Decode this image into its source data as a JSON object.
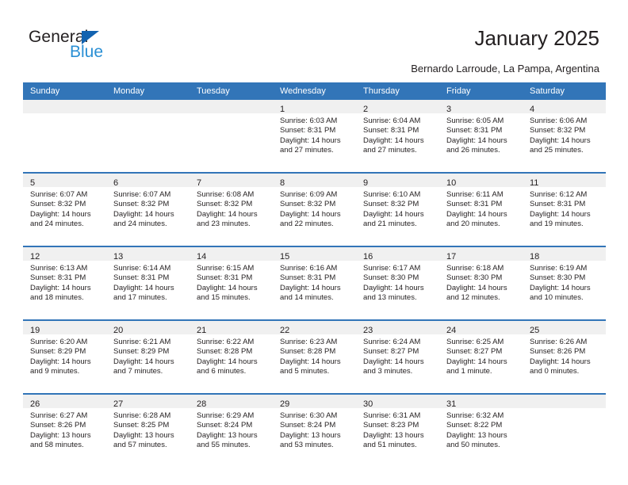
{
  "brand": {
    "name_top": "General",
    "name_bottom": "Blue",
    "accent_color": "#1263b0",
    "accent_light": "#2a8fd4"
  },
  "header": {
    "title": "January 2025",
    "subtitle": "Bernardo Larroude, La Pampa, Argentina"
  },
  "calendar": {
    "header_color": "#3275b8",
    "weekday_headers": [
      "Sunday",
      "Monday",
      "Tuesday",
      "Wednesday",
      "Thursday",
      "Friday",
      "Saturday"
    ],
    "weeks": [
      [
        {
          "day": "",
          "lines": []
        },
        {
          "day": "",
          "lines": []
        },
        {
          "day": "",
          "lines": []
        },
        {
          "day": "1",
          "lines": [
            "Sunrise: 6:03 AM",
            "Sunset: 8:31 PM",
            "Daylight: 14 hours",
            "and 27 minutes."
          ]
        },
        {
          "day": "2",
          "lines": [
            "Sunrise: 6:04 AM",
            "Sunset: 8:31 PM",
            "Daylight: 14 hours",
            "and 27 minutes."
          ]
        },
        {
          "day": "3",
          "lines": [
            "Sunrise: 6:05 AM",
            "Sunset: 8:31 PM",
            "Daylight: 14 hours",
            "and 26 minutes."
          ]
        },
        {
          "day": "4",
          "lines": [
            "Sunrise: 6:06 AM",
            "Sunset: 8:32 PM",
            "Daylight: 14 hours",
            "and 25 minutes."
          ]
        }
      ],
      [
        {
          "day": "5",
          "lines": [
            "Sunrise: 6:07 AM",
            "Sunset: 8:32 PM",
            "Daylight: 14 hours",
            "and 24 minutes."
          ]
        },
        {
          "day": "6",
          "lines": [
            "Sunrise: 6:07 AM",
            "Sunset: 8:32 PM",
            "Daylight: 14 hours",
            "and 24 minutes."
          ]
        },
        {
          "day": "7",
          "lines": [
            "Sunrise: 6:08 AM",
            "Sunset: 8:32 PM",
            "Daylight: 14 hours",
            "and 23 minutes."
          ]
        },
        {
          "day": "8",
          "lines": [
            "Sunrise: 6:09 AM",
            "Sunset: 8:32 PM",
            "Daylight: 14 hours",
            "and 22 minutes."
          ]
        },
        {
          "day": "9",
          "lines": [
            "Sunrise: 6:10 AM",
            "Sunset: 8:32 PM",
            "Daylight: 14 hours",
            "and 21 minutes."
          ]
        },
        {
          "day": "10",
          "lines": [
            "Sunrise: 6:11 AM",
            "Sunset: 8:31 PM",
            "Daylight: 14 hours",
            "and 20 minutes."
          ]
        },
        {
          "day": "11",
          "lines": [
            "Sunrise: 6:12 AM",
            "Sunset: 8:31 PM",
            "Daylight: 14 hours",
            "and 19 minutes."
          ]
        }
      ],
      [
        {
          "day": "12",
          "lines": [
            "Sunrise: 6:13 AM",
            "Sunset: 8:31 PM",
            "Daylight: 14 hours",
            "and 18 minutes."
          ]
        },
        {
          "day": "13",
          "lines": [
            "Sunrise: 6:14 AM",
            "Sunset: 8:31 PM",
            "Daylight: 14 hours",
            "and 17 minutes."
          ]
        },
        {
          "day": "14",
          "lines": [
            "Sunrise: 6:15 AM",
            "Sunset: 8:31 PM",
            "Daylight: 14 hours",
            "and 15 minutes."
          ]
        },
        {
          "day": "15",
          "lines": [
            "Sunrise: 6:16 AM",
            "Sunset: 8:31 PM",
            "Daylight: 14 hours",
            "and 14 minutes."
          ]
        },
        {
          "day": "16",
          "lines": [
            "Sunrise: 6:17 AM",
            "Sunset: 8:30 PM",
            "Daylight: 14 hours",
            "and 13 minutes."
          ]
        },
        {
          "day": "17",
          "lines": [
            "Sunrise: 6:18 AM",
            "Sunset: 8:30 PM",
            "Daylight: 14 hours",
            "and 12 minutes."
          ]
        },
        {
          "day": "18",
          "lines": [
            "Sunrise: 6:19 AM",
            "Sunset: 8:30 PM",
            "Daylight: 14 hours",
            "and 10 minutes."
          ]
        }
      ],
      [
        {
          "day": "19",
          "lines": [
            "Sunrise: 6:20 AM",
            "Sunset: 8:29 PM",
            "Daylight: 14 hours",
            "and 9 minutes."
          ]
        },
        {
          "day": "20",
          "lines": [
            "Sunrise: 6:21 AM",
            "Sunset: 8:29 PM",
            "Daylight: 14 hours",
            "and 7 minutes."
          ]
        },
        {
          "day": "21",
          "lines": [
            "Sunrise: 6:22 AM",
            "Sunset: 8:28 PM",
            "Daylight: 14 hours",
            "and 6 minutes."
          ]
        },
        {
          "day": "22",
          "lines": [
            "Sunrise: 6:23 AM",
            "Sunset: 8:28 PM",
            "Daylight: 14 hours",
            "and 5 minutes."
          ]
        },
        {
          "day": "23",
          "lines": [
            "Sunrise: 6:24 AM",
            "Sunset: 8:27 PM",
            "Daylight: 14 hours",
            "and 3 minutes."
          ]
        },
        {
          "day": "24",
          "lines": [
            "Sunrise: 6:25 AM",
            "Sunset: 8:27 PM",
            "Daylight: 14 hours",
            "and 1 minute."
          ]
        },
        {
          "day": "25",
          "lines": [
            "Sunrise: 6:26 AM",
            "Sunset: 8:26 PM",
            "Daylight: 14 hours",
            "and 0 minutes."
          ]
        }
      ],
      [
        {
          "day": "26",
          "lines": [
            "Sunrise: 6:27 AM",
            "Sunset: 8:26 PM",
            "Daylight: 13 hours",
            "and 58 minutes."
          ]
        },
        {
          "day": "27",
          "lines": [
            "Sunrise: 6:28 AM",
            "Sunset: 8:25 PM",
            "Daylight: 13 hours",
            "and 57 minutes."
          ]
        },
        {
          "day": "28",
          "lines": [
            "Sunrise: 6:29 AM",
            "Sunset: 8:24 PM",
            "Daylight: 13 hours",
            "and 55 minutes."
          ]
        },
        {
          "day": "29",
          "lines": [
            "Sunrise: 6:30 AM",
            "Sunset: 8:24 PM",
            "Daylight: 13 hours",
            "and 53 minutes."
          ]
        },
        {
          "day": "30",
          "lines": [
            "Sunrise: 6:31 AM",
            "Sunset: 8:23 PM",
            "Daylight: 13 hours",
            "and 51 minutes."
          ]
        },
        {
          "day": "31",
          "lines": [
            "Sunrise: 6:32 AM",
            "Sunset: 8:22 PM",
            "Daylight: 13 hours",
            "and 50 minutes."
          ]
        },
        {
          "day": "",
          "lines": []
        }
      ]
    ]
  }
}
